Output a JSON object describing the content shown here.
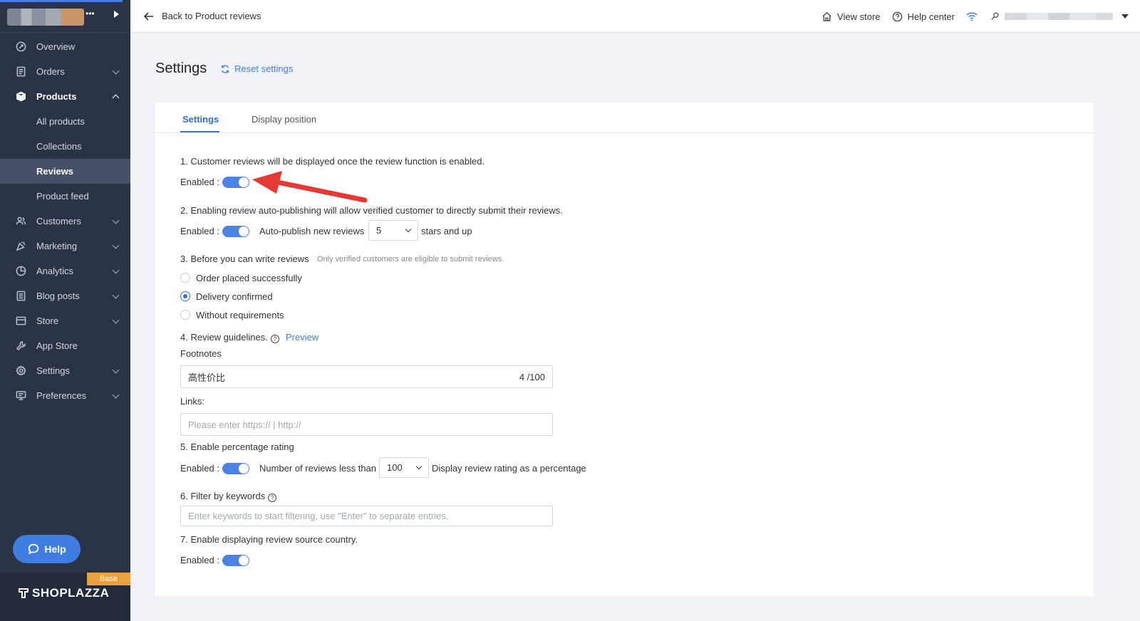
{
  "sidebar": {
    "items": [
      {
        "label": "Overview",
        "icon": "overview-icon",
        "chevron": false
      },
      {
        "label": "Orders",
        "icon": "orders-icon",
        "chevron": true
      },
      {
        "label": "Products",
        "icon": "products-icon",
        "chevron": true,
        "expanded": true
      },
      {
        "label": "Customers",
        "icon": "customers-icon",
        "chevron": true
      },
      {
        "label": "Marketing",
        "icon": "marketing-icon",
        "chevron": true
      },
      {
        "label": "Analytics",
        "icon": "analytics-icon",
        "chevron": true
      },
      {
        "label": "Blog posts",
        "icon": "blog-icon",
        "chevron": true
      },
      {
        "label": "Store",
        "icon": "store-icon",
        "chevron": true
      },
      {
        "label": "App Store",
        "icon": "app-store-icon",
        "chevron": false
      },
      {
        "label": "Settings",
        "icon": "settings-icon",
        "chevron": true
      },
      {
        "label": "Preferences",
        "icon": "preferences-icon",
        "chevron": true
      }
    ],
    "product_subitems": [
      "All products",
      "Collections",
      "Reviews",
      "Product feed"
    ],
    "active_subitem": "Reviews",
    "help_label": "Help",
    "plan_badge": "Base",
    "brand": "SHOPLAZZA"
  },
  "topbar": {
    "back_label": "Back to Product reviews",
    "view_store": "View store",
    "help_center": "Help center"
  },
  "page": {
    "title": "Settings",
    "reset_label": "Reset settings"
  },
  "tabs": [
    "Settings",
    "Display position"
  ],
  "sections": {
    "s1": {
      "text": "1. Customer reviews will be displayed once the review function is enabled.",
      "enabled_label": "Enabled :",
      "enabled": true
    },
    "s2": {
      "text": "2. Enabling review auto-publishing will allow verified customer to directly submit their reviews.",
      "enabled_label": "Enabled :",
      "enabled": true,
      "auto_label": "Auto-publish new reviews",
      "stars_value": "5",
      "stars_suffix": "stars and up"
    },
    "s3": {
      "title": "3. Before you can write reviews",
      "hint": "Only verified customers are eligible to submit reviews.",
      "options": [
        "Order placed successfully",
        "Delivery confirmed",
        "Without requirements"
      ],
      "selected": "Delivery confirmed"
    },
    "s4": {
      "title": "4. Review guidelines.",
      "preview": "Preview",
      "footnotes_label": "Footnotes",
      "footnotes_value": "高性价比",
      "footnotes_counter": "4 /100",
      "links_label": "Links:",
      "links_placeholder": "Please enter https:// | http://"
    },
    "s5": {
      "title": "5. Enable percentage rating",
      "enabled_label": "Enabled :",
      "enabled": true,
      "count_label": "Number of reviews less than",
      "count_value": "100",
      "suffix": "Display review rating as a percentage"
    },
    "s6": {
      "title": "6. Filter by keywords",
      "placeholder": "Enter keywords to start filtering, use \"Enter\" to separate entries."
    },
    "s7": {
      "title": "7. Enable displaying review source country.",
      "enabled_label": "Enabled :",
      "enabled": true
    }
  },
  "colors": {
    "accent": "#3f7ee0",
    "sidebar_bg": "#2b3447",
    "annotation_arrow": "#e53935"
  }
}
